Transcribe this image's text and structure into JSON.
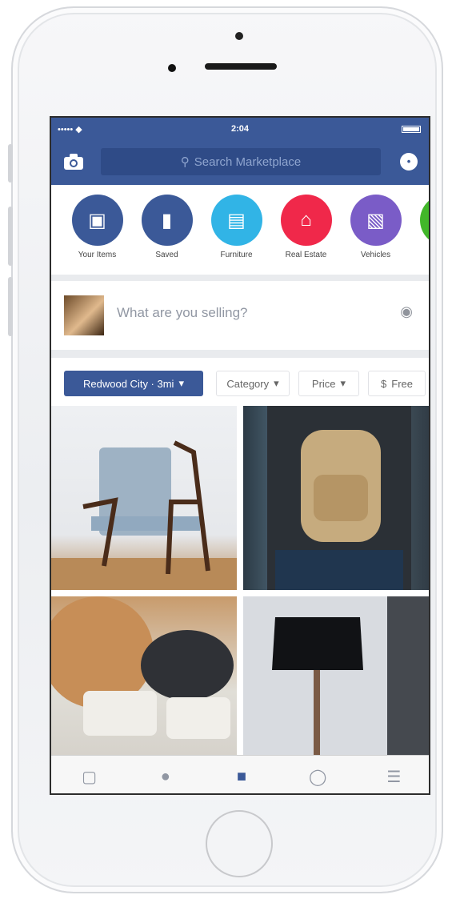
{
  "status": {
    "left": "••••• ◆",
    "time": "2:04"
  },
  "search": {
    "placeholder": "Search Marketplace"
  },
  "shortcuts": [
    {
      "label": "Your Items",
      "color": "#3b5998",
      "icon": "box-icon"
    },
    {
      "label": "Saved",
      "color": "#3b5998",
      "icon": "bookmark-icon"
    },
    {
      "label": "Furniture",
      "color": "#31b4e6",
      "icon": "sofa-icon"
    },
    {
      "label": "Real Estate",
      "color": "#f0284a",
      "icon": "house-icon"
    },
    {
      "label": "Vehicles",
      "color": "#7a5cc7",
      "icon": "car-icon"
    }
  ],
  "composer": {
    "prompt": "What are you selling?"
  },
  "filters": {
    "location": "Redwood City · 3mi",
    "category": "Category",
    "price": "Price",
    "free": "Free"
  },
  "tabs": [
    {
      "name": "news-feed-icon"
    },
    {
      "name": "video-icon"
    },
    {
      "name": "marketplace-icon",
      "active": true
    },
    {
      "name": "globe-icon"
    },
    {
      "name": "menu-icon"
    }
  ]
}
